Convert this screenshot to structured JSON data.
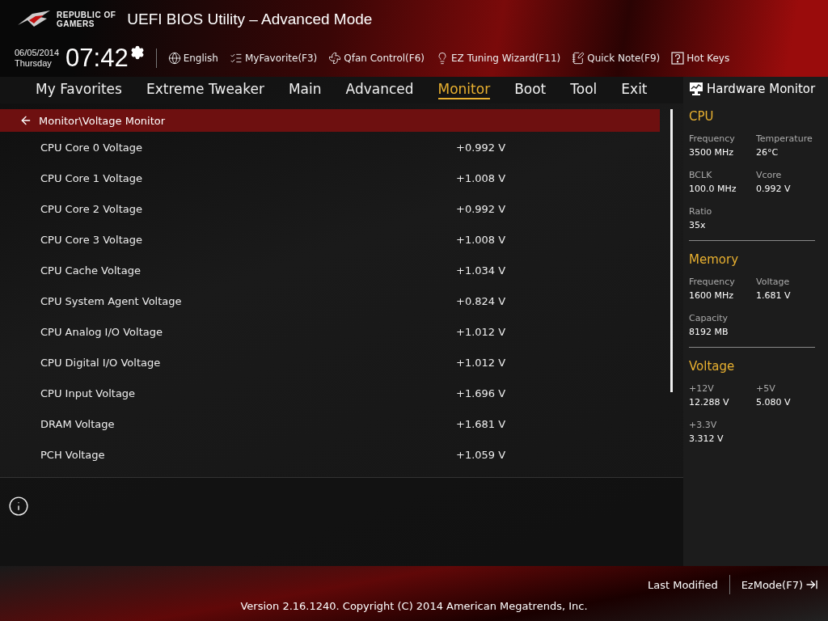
{
  "header": {
    "brand_line_1": "REPUBLIC OF",
    "brand_line_2": "GAMERS",
    "title": "UEFI BIOS Utility – Advanced Mode"
  },
  "clock": {
    "date": "06/05/2014",
    "day": "Thursday",
    "time": "07:42"
  },
  "toolbar": [
    {
      "kind": "globe",
      "label": "English"
    },
    {
      "kind": "favorite",
      "label": "MyFavorite(F3)"
    },
    {
      "kind": "fan",
      "label": "Qfan Control(F6)"
    },
    {
      "kind": "bulb",
      "label": "EZ Tuning Wizard(F11)"
    },
    {
      "kind": "note",
      "label": "Quick Note(F9)"
    },
    {
      "kind": "help",
      "label": "Hot Keys"
    }
  ],
  "tabs": [
    {
      "label": "My Favorites",
      "selected": false
    },
    {
      "label": "Extreme Tweaker",
      "selected": false
    },
    {
      "label": "Main",
      "selected": false
    },
    {
      "label": "Advanced",
      "selected": false
    },
    {
      "label": "Monitor",
      "selected": true
    },
    {
      "label": "Boot",
      "selected": false
    },
    {
      "label": "Tool",
      "selected": false
    },
    {
      "label": "Exit",
      "selected": false
    }
  ],
  "breadcrumb": "Monitor\\Voltage Monitor",
  "rows": [
    {
      "label": "CPU Core 0 Voltage",
      "value": "+0.992 V"
    },
    {
      "label": "CPU Core 1 Voltage",
      "value": "+1.008 V"
    },
    {
      "label": "CPU Core 2 Voltage",
      "value": "+0.992 V"
    },
    {
      "label": "CPU Core 3 Voltage",
      "value": "+1.008 V"
    },
    {
      "label": "CPU Cache Voltage",
      "value": "+1.034 V"
    },
    {
      "label": "CPU System Agent Voltage",
      "value": "+0.824 V"
    },
    {
      "label": "CPU Analog I/O Voltage",
      "value": "+1.012 V"
    },
    {
      "label": "CPU Digital I/O Voltage",
      "value": "+1.012 V"
    },
    {
      "label": "CPU Input Voltage",
      "value": "+1.696 V"
    },
    {
      "label": "DRAM Voltage",
      "value": "+1.681 V"
    },
    {
      "label": "PCH Voltage",
      "value": "+1.059 V"
    }
  ],
  "hardware_monitor": {
    "title": "Hardware Monitor",
    "sections": [
      {
        "title": "CPU",
        "items": [
          {
            "label": "Frequency",
            "value": "3500 MHz"
          },
          {
            "label": "Temperature",
            "value": "26°C"
          },
          {
            "label": "BCLK",
            "value": "100.0 MHz"
          },
          {
            "label": "Vcore",
            "value": "0.992 V"
          },
          {
            "label": "Ratio",
            "value": "35x"
          }
        ]
      },
      {
        "title": "Memory",
        "items": [
          {
            "label": "Frequency",
            "value": "1600 MHz"
          },
          {
            "label": "Voltage",
            "value": "1.681 V"
          },
          {
            "label": "Capacity",
            "value": "8192 MB"
          }
        ]
      },
      {
        "title": "Voltage",
        "items": [
          {
            "label": "+12V",
            "value": "12.288 V"
          },
          {
            "label": "+5V",
            "value": "5.080 V"
          },
          {
            "label": "+3.3V",
            "value": "3.312 V"
          }
        ]
      }
    ]
  },
  "footer": {
    "last_modified": "Last Modified",
    "ez_mode": "EzMode(F7)",
    "copyright": "Version 2.16.1240. Copyright (C) 2014 American Megatrends, Inc."
  }
}
